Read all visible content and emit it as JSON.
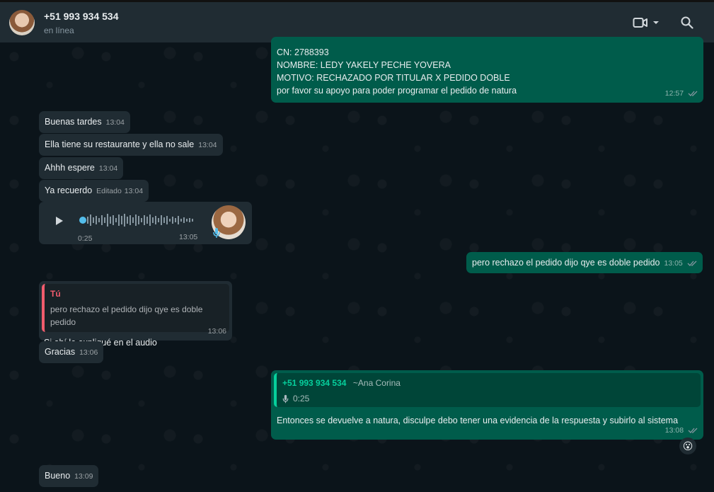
{
  "header": {
    "contact_name": "+51 993 934 534",
    "status": "en línea"
  },
  "messages": {
    "top_out": {
      "lines": [
        "CN: 2788393",
        "NOMBRE: LEDY YAKELY PECHE YOVERA",
        "MOTIVO: RECHAZADO POR TITULAR X PEDIDO DOBLE",
        "por favor  su apoyo para poder programar el pedido de natura"
      ],
      "time": "12:57"
    },
    "m1": {
      "text": "Buenas tardes",
      "time": "13:04"
    },
    "m2": {
      "text": "Ella tiene su restaurante y ella no sale",
      "time": "13:04"
    },
    "m3": {
      "text": "Ahhh espere",
      "time": "13:04"
    },
    "m4": {
      "text": "Ya recuerdo",
      "edited": "Editado",
      "time": "13:04"
    },
    "audio": {
      "duration": "0:25",
      "time": "13:05",
      "progress": 0
    },
    "out1": {
      "text": "pero rechazo el pedido dijo qye es doble pedido",
      "time": "13:05"
    },
    "reply": {
      "quote_author": "Tú",
      "quote_text": "pero rechazo el pedido dijo qye es doble pedido",
      "text": "Si ahí le expliqué en el audio",
      "time": "13:06"
    },
    "m5": {
      "text": "Gracias",
      "time": "13:06"
    },
    "out2": {
      "quote_author": "+51 993 934 534",
      "quote_sender": "~Ana Corina",
      "quote_audio_duration": "0:25",
      "text": "Entonces se devuelve a natura, disculpe debo tener una evidencia de la respuesta y subirlo al sistema",
      "time": "13:08",
      "reaction": "😮"
    },
    "m6": {
      "text": "Bueno",
      "time": "13:09"
    }
  },
  "colors": {
    "header_bg": "#202c33",
    "chat_bg": "#0b141a",
    "incoming_bg": "#202c33",
    "outgoing_bg": "#005c4b",
    "read_ticks": "#8696a0",
    "self_quote": "#f15c6d",
    "contact_quote": "#06cf9c",
    "audio_accent": "#53bdeb"
  },
  "icons": {
    "video": "video-camera-icon",
    "dropdown": "chevron-down-icon",
    "search": "search-icon",
    "play": "play-icon",
    "mic": "microphone-icon"
  }
}
